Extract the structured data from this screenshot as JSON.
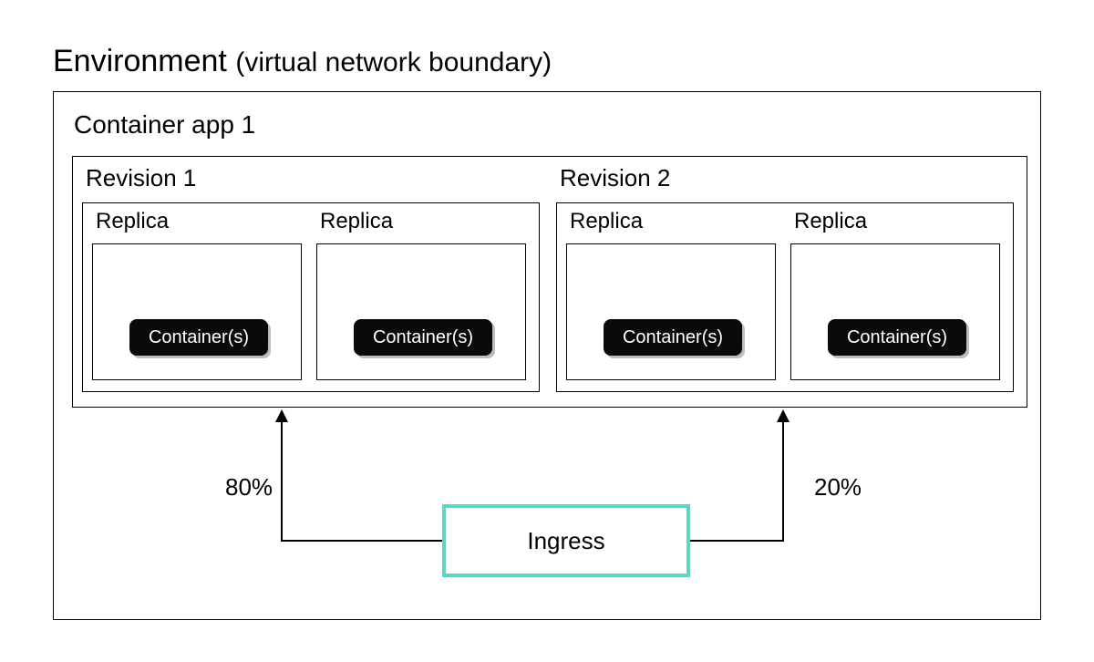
{
  "title_main": "Environment",
  "title_sub": "(virtual network boundary)",
  "environment": {
    "app_label": "Container app 1",
    "revisions": [
      {
        "label": "Revision 1",
        "replicas": [
          {
            "label": "Replica",
            "container_label": "Container(s)"
          },
          {
            "label": "Replica",
            "container_label": "Container(s)"
          }
        ]
      },
      {
        "label": "Revision 2",
        "replicas": [
          {
            "label": "Replica",
            "container_label": "Container(s)"
          },
          {
            "label": "Replica",
            "container_label": "Container(s)"
          }
        ]
      }
    ],
    "ingress_label": "Ingress",
    "traffic_split": [
      {
        "target": "Revision 1",
        "percent_label": "80%",
        "percent": 80
      },
      {
        "target": "Revision 2",
        "percent_label": "20%",
        "percent": 20
      }
    ]
  }
}
